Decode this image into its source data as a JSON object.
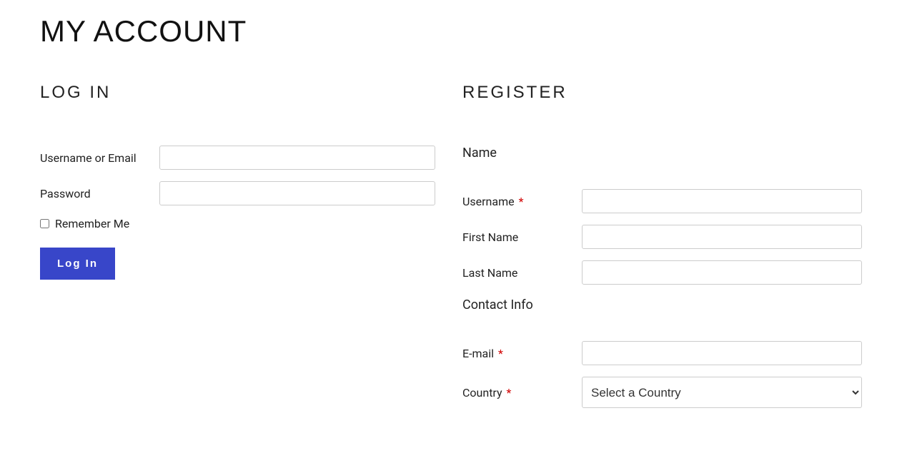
{
  "page": {
    "title": "MY ACCOUNT"
  },
  "login": {
    "heading": "LOG IN",
    "username_label": "Username or Email",
    "username_value": "",
    "password_label": "Password",
    "password_value": "",
    "remember_label": "Remember Me",
    "button_label": "Log In"
  },
  "register": {
    "heading": "REGISTER",
    "section_name": "Name",
    "username_label": "Username",
    "username_value": "",
    "firstname_label": "First Name",
    "firstname_value": "",
    "lastname_label": "Last Name",
    "lastname_value": "",
    "section_contact": "Contact Info",
    "email_label": "E-mail",
    "email_value": "",
    "country_label": "Country",
    "country_placeholder": "Select a Country",
    "required_marker": "*"
  }
}
